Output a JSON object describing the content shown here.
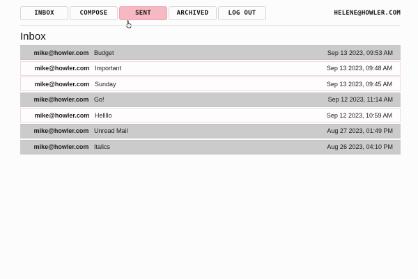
{
  "nav": {
    "items": [
      {
        "label": "INBOX",
        "active": false
      },
      {
        "label": "COMPOSE",
        "active": false
      },
      {
        "label": "SENT",
        "active": true
      },
      {
        "label": "ARCHIVED",
        "active": false
      },
      {
        "label": "LOG OUT",
        "active": false
      }
    ],
    "user_email": "HELENE@HOWLER.COM"
  },
  "page_title": "Inbox",
  "colors": {
    "active_tab": "#f6b8c3",
    "read_row": "#cbcbcb",
    "unread_row": "#fdfdfd",
    "unread_border": "#f3d7dd"
  },
  "icons": {
    "cursor": "hand-pointer-icon"
  },
  "emails": [
    {
      "from": "mike@howler.com",
      "subject": "Budget",
      "date": "Sep 13 2023, 09:53 AM",
      "read": true
    },
    {
      "from": "mike@howler.com",
      "subject": "Important",
      "date": "Sep 13 2023, 09:48 AM",
      "read": false
    },
    {
      "from": "mike@howler.com",
      "subject": "Sunday",
      "date": "Sep 13 2023, 09:45 AM",
      "read": false
    },
    {
      "from": "mike@howler.com",
      "subject": "Go!",
      "date": "Sep 12 2023, 11:14 AM",
      "read": true
    },
    {
      "from": "mike@howler.com",
      "subject": "Hellllo",
      "date": "Sep 12 2023, 10:59 AM",
      "read": false
    },
    {
      "from": "mike@howler.com",
      "subject": "Unread Mail",
      "date": "Aug 27 2023, 01:49 PM",
      "read": true
    },
    {
      "from": "mike@howler.com",
      "subject": "Italics",
      "date": "Aug 26 2023, 04:10 PM",
      "read": true
    }
  ]
}
